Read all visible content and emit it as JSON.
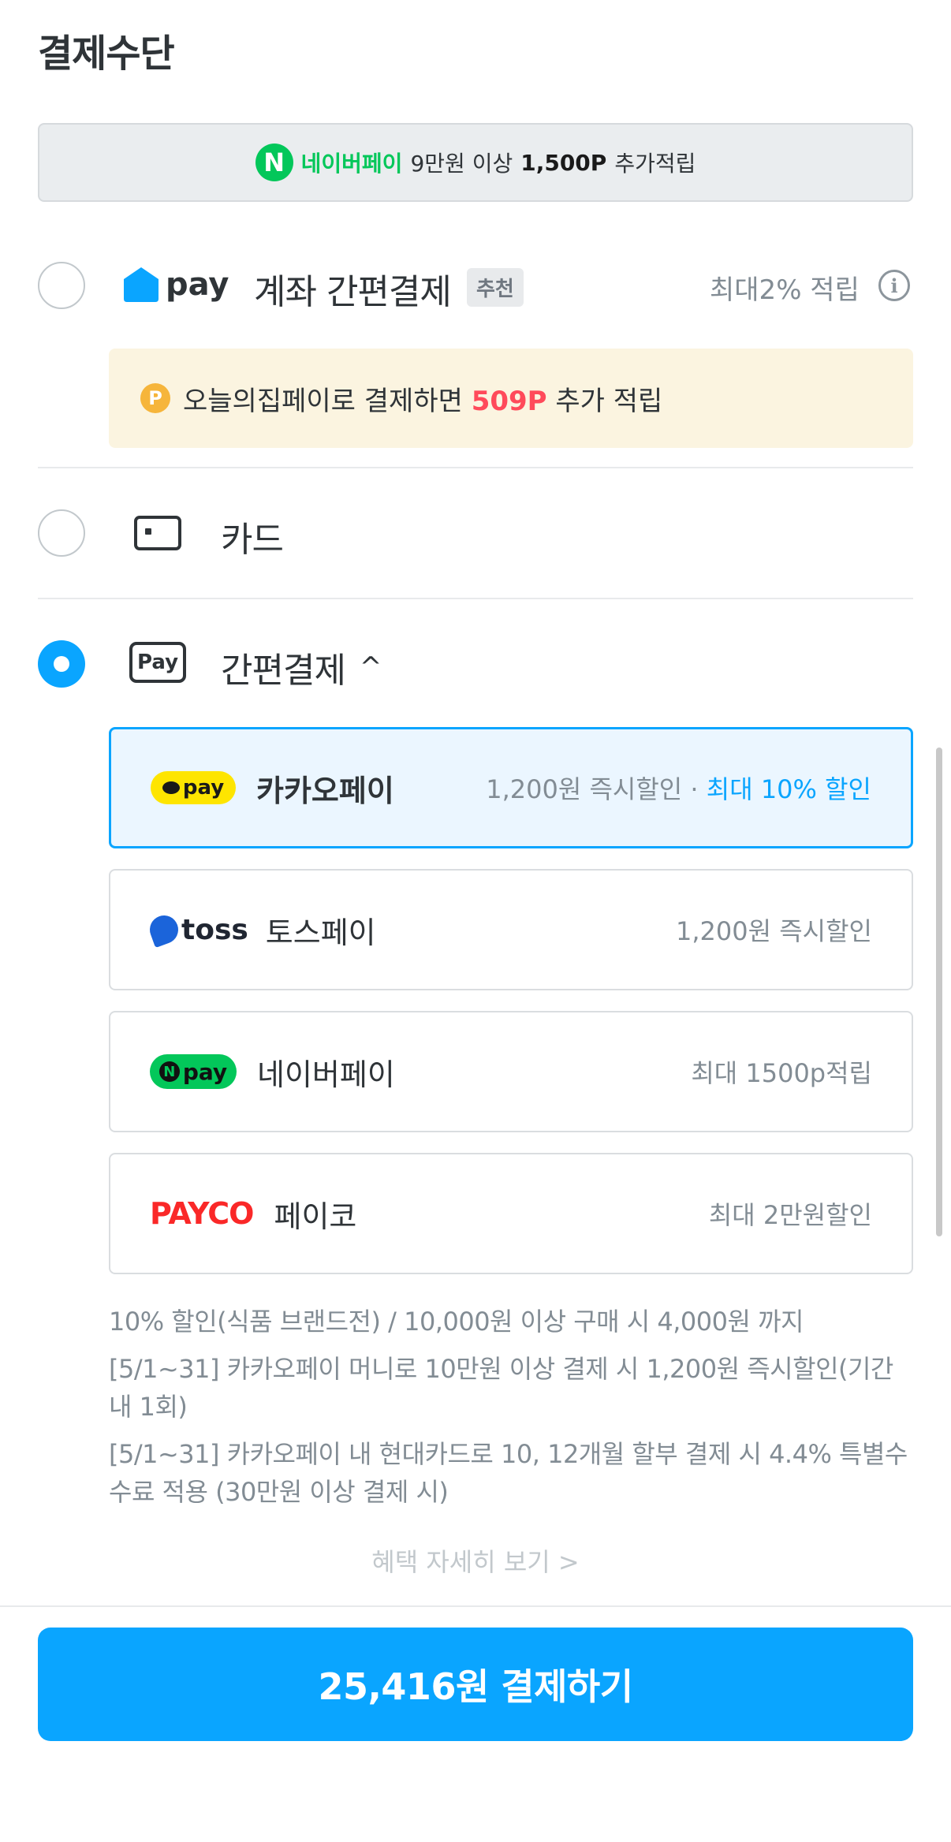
{
  "page": {
    "title": "결제수단"
  },
  "naver_banner": {
    "logo_letter": "N",
    "brand": "네이버페이",
    "text": "9만원 이상",
    "bold": "1,500P",
    "suffix": "추가적립"
  },
  "methods": {
    "ohouse_pay": {
      "logo_text": "pay",
      "label": "계좌 간편결제",
      "badge": "추천",
      "reward": "최대2% 적립",
      "info_glyph": "i",
      "promo": {
        "coin_letter": "P",
        "prefix": "오늘의집페이로 결제하면",
        "amount": "509P",
        "suffix": "추가 적립"
      }
    },
    "card": {
      "label": "카드"
    },
    "easy_pay": {
      "icon_text": "Pay",
      "label": "간편결제",
      "chevron": "^",
      "options": [
        {
          "logo_text": "pay",
          "name": "카카오페이",
          "info": "1,200원 즉시할인 ·",
          "accent": "최대 10% 할인",
          "selected": true
        },
        {
          "logo_text": "toss",
          "name": "토스페이",
          "info": "1,200원 즉시할인"
        },
        {
          "logo_letter": "N",
          "logo_text": "pay",
          "name": "네이버페이",
          "info": "최대 1500p적립"
        },
        {
          "logo_text": "PAYCO",
          "name": "페이코",
          "info": "최대 2만원할인"
        }
      ]
    }
  },
  "benefits": [
    "10% 할인(식품 브랜드전) / 10,000원 이상 구매 시 4,000원 까지",
    "[5/1~31] 카카오페이 머니로 10만원 이상 결제 시 1,200원 즉시할인(기간 내 1회)",
    "[5/1~31] 카카오페이 내 현대카드로 10, 12개월 할부 결제 시 4.4% 특별수수료 적용 (30만원 이상 결제 시)"
  ],
  "detail_link": "혜택 자세히 보기  >",
  "pay_button": "25,416원 결제하기",
  "colors": {
    "accent": "#0aa5ff",
    "naver": "#03c75a",
    "kakao": "#fee500",
    "payco": "#fa2828",
    "promo_red": "#ff4a5a"
  }
}
